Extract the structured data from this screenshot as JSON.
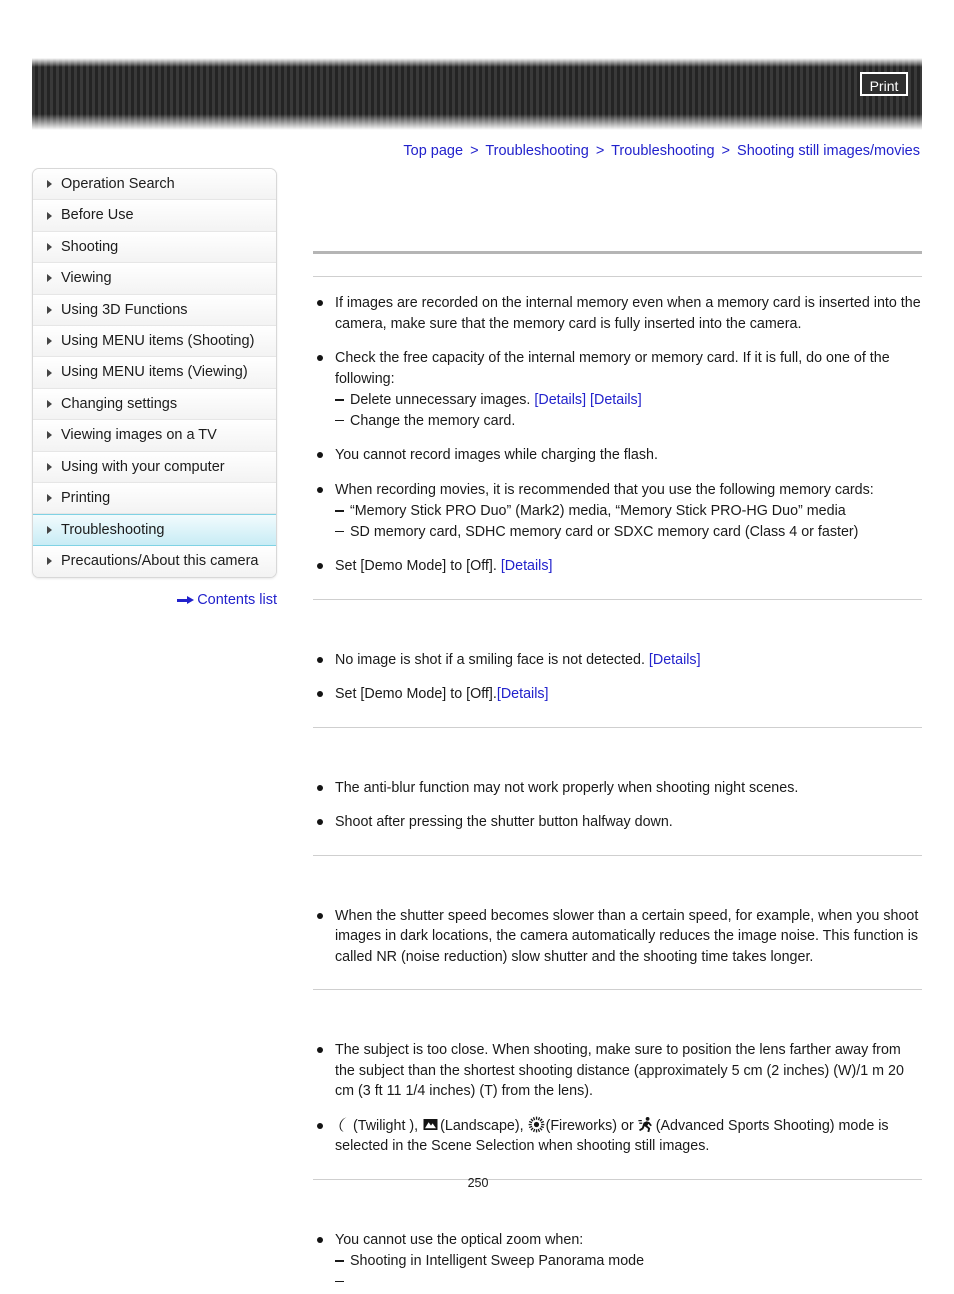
{
  "header": {
    "print_label": "Print"
  },
  "breadcrumb": {
    "separator": ">",
    "items": [
      {
        "label": "Top page"
      },
      {
        "label": "Troubleshooting"
      },
      {
        "label": "Troubleshooting"
      },
      {
        "label": "Shooting still images/movies"
      }
    ]
  },
  "sidebar": {
    "items": [
      {
        "label": "Operation Search",
        "active": false
      },
      {
        "label": "Before Use",
        "active": false
      },
      {
        "label": "Shooting",
        "active": false
      },
      {
        "label": "Viewing",
        "active": false
      },
      {
        "label": "Using 3D Functions",
        "active": false
      },
      {
        "label": "Using MENU items (Shooting)",
        "active": false
      },
      {
        "label": "Using MENU items (Viewing)",
        "active": false
      },
      {
        "label": "Changing settings",
        "active": false
      },
      {
        "label": "Viewing images on a TV",
        "active": false
      },
      {
        "label": "Using with your computer",
        "active": false
      },
      {
        "label": "Printing",
        "active": false
      },
      {
        "label": "Troubleshooting",
        "active": true
      },
      {
        "label": "Precautions/About this camera",
        "active": false
      }
    ],
    "contents_link": "Contents list"
  },
  "main": {
    "section1": {
      "heading": "",
      "b1": "If images are recorded on the internal memory even when a memory card is inserted into the camera, make sure that the memory card is fully inserted into the camera.",
      "b2": "Check the free capacity of the internal memory or memory card. If it is full, do one of the following:",
      "b2d1": "Delete unnecessary images.",
      "b2d1_link1": "[Details]",
      "b2d1_link2": "[Details]",
      "b2d2": "Change the memory card.",
      "b3": "You cannot record images while charging the flash.",
      "b4": "When recording movies, it is recommended that you use the following memory cards:",
      "b4d1": "“Memory Stick PRO Duo” (Mark2) media, “Memory Stick PRO-HG Duo” media",
      "b4d2": "SD memory card, SDHC memory card or SDXC memory card (Class 4 or faster)",
      "b5": "Set [Demo Mode] to [Off].",
      "b5_link": "[Details]"
    },
    "section2": {
      "heading": "",
      "b1": "No image is shot if a smiling face is not detected.",
      "b1_link": "[Details]",
      "b2": "Set [Demo Mode] to [Off].",
      "b2_link": "[Details]"
    },
    "section3": {
      "heading": "",
      "b1": "The anti-blur function may not work properly when shooting night scenes.",
      "b2": "Shoot after pressing the shutter button halfway down."
    },
    "section4": {
      "heading": "",
      "b1": "When the shutter speed becomes slower than a certain speed, for example, when you shoot images in dark locations, the camera automatically reduces the image noise. This function is called NR (noise reduction) slow shutter and the shooting time takes longer."
    },
    "section5": {
      "heading": "",
      "b1": "The subject is too close. When shooting, make sure to position the lens farther away from the subject than the shortest shooting distance (approximately 5 cm (2 inches) (W)/1 m 20 cm (3 ft 11 1/4 inches) (T) from the lens).",
      "b2_part1": "(Twilight ),",
      "b2_part2": "(Landscape),",
      "b2_part3": "(Fireworks) or",
      "b2_part4": "(Advanced Sports Shooting) mode is selected in the Scene Selection when shooting still images.",
      "icons": {
        "twilight": "twilight-moon-icon",
        "landscape": "landscape-mountain-icon",
        "fireworks": "fireworks-burst-icon",
        "sports": "advanced-sports-shooting-icon"
      }
    },
    "section6": {
      "heading": "",
      "b1": "You cannot use the optical zoom when:",
      "b1d1": "Shooting in Intelligent Sweep Panorama mode",
      "b1d2": ""
    }
  },
  "footer": {
    "page_number": "250"
  },
  "colors": {
    "link": "#2222cc",
    "active_sidebar": "#c8ecf5",
    "active_border": "#7fd2e4",
    "rule_thick": "#b5b5b5",
    "rule_thin": "#cfcfcf"
  }
}
